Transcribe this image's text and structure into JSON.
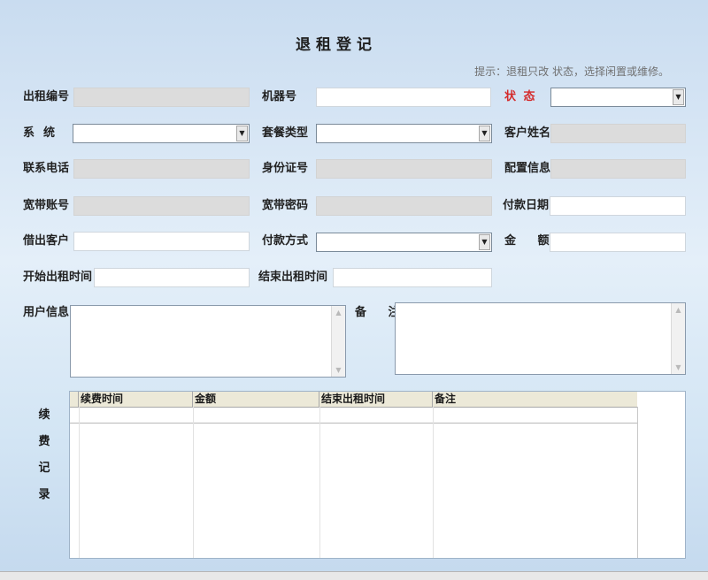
{
  "form": {
    "title": "退租登记",
    "hint": "提示：退租只改 状态，选择闲置或维修。"
  },
  "fields": {
    "rental_no": {
      "label": "出租编号",
      "value": ""
    },
    "machine_no": {
      "label": "机器号",
      "value": ""
    },
    "status": {
      "label": "状 态",
      "value": ""
    },
    "system": {
      "label": "系统",
      "value": ""
    },
    "package_type": {
      "label": "套餐类型",
      "value": ""
    },
    "customer_name": {
      "label": "客户姓名",
      "value": ""
    },
    "phone": {
      "label": "联系电话",
      "value": ""
    },
    "id_no": {
      "label": "身份证号",
      "value": ""
    },
    "config": {
      "label": "配置信息",
      "value": ""
    },
    "bb_account": {
      "label": "宽带账号",
      "value": ""
    },
    "bb_password": {
      "label": "宽带密码",
      "value": ""
    },
    "pay_date": {
      "label": "付款日期",
      "value": ""
    },
    "lend_customer": {
      "label": "借出客户",
      "value": ""
    },
    "pay_method": {
      "label": "付款方式",
      "value": ""
    },
    "amount": {
      "label": "金 额",
      "value": ""
    },
    "start_time": {
      "label": "开始出租时间",
      "value": ""
    },
    "end_time": {
      "label": "结束出租时间",
      "value": ""
    },
    "user_info": {
      "label": "用户信息",
      "value": ""
    },
    "remark": {
      "label": "备 注",
      "value": ""
    }
  },
  "renewal": {
    "side_label": [
      "续",
      "费",
      "记",
      "录"
    ],
    "columns": [
      "续费时间",
      "金额",
      "结束出租时间",
      "备注"
    ]
  },
  "colors": {
    "status_label": "#d42a2a",
    "readonly_bg": "#dcdcdc",
    "background": "#d6e6f5"
  }
}
